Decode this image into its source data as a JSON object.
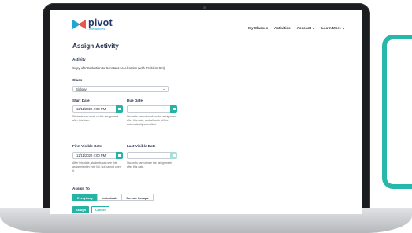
{
  "nav": {
    "logo_word": "pivot",
    "logo_sub": "interactives",
    "items": [
      "My Classes",
      "Activities",
      "Account ⌄",
      "Learn More ⌄"
    ]
  },
  "page": {
    "title": "Assign Activity",
    "activity_label": "Activity",
    "activity_value": "Copy of Introduction to Constant Acceleration (with Problem Set)",
    "class_label": "Class",
    "class_value": "Biology",
    "start_date_label": "Start Date",
    "start_date_value": "11/11/2022 4:00 PM",
    "start_date_hint": "Students can work on the assignment after this date.",
    "due_date_label": "Due Date",
    "due_date_value": "",
    "due_date_hint": "Students cannot work on the assignment after this date, and all work will be automatically submitted.",
    "first_visible_label": "First Visible Date",
    "first_visible_value": "11/11/2022 4:00 PM",
    "first_visible_hint": "After this date, students can see this assignment in their list, but cannot open it.",
    "last_visible_label": "Last Visible Date",
    "last_visible_value": "",
    "last_visible_hint": "Students cannot see the assignment after this date.",
    "assign_to_label": "Assign To",
    "assign_to_options": [
      "Everybody",
      "Individuals",
      "Co-Lab Groups"
    ],
    "assign_button": "Assign",
    "cancel_button": "Cancel"
  },
  "colors": {
    "accent": "#26b2a5",
    "brand_dark": "#233b6a",
    "brand_blue": "#1fa6d4",
    "brand_red": "#e8574a"
  }
}
